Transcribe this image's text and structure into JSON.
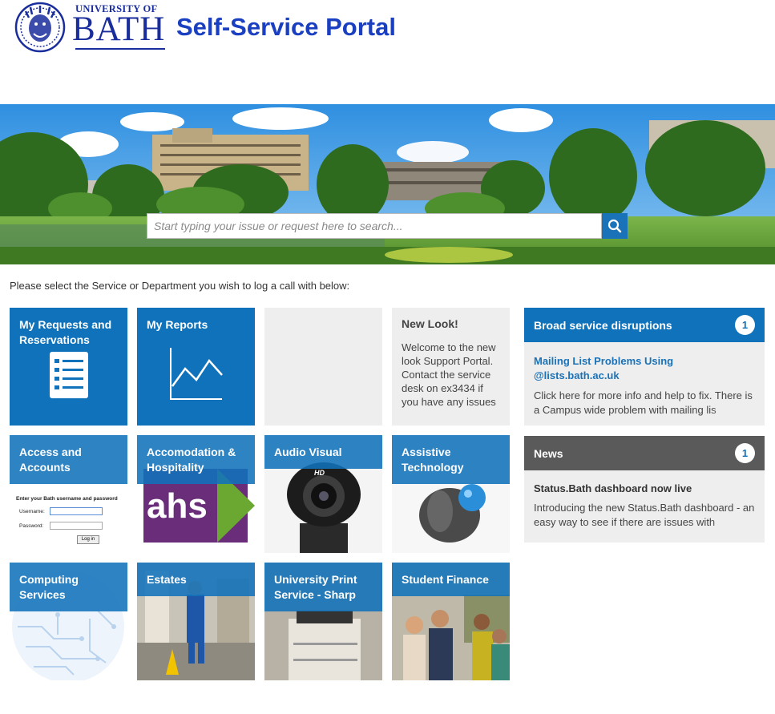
{
  "header": {
    "logo_university": "UNIVERSITY OF",
    "logo_bath": "BATH",
    "portal_title": "Self-Service Portal"
  },
  "search": {
    "placeholder": "Start typing your issue or request here to search...",
    "icon": "search-icon"
  },
  "intro_text": "Please select the Service or Department you wish to log a call with below:",
  "tiles": {
    "requests": {
      "label": "My Requests and Reservations",
      "icon": "list-icon"
    },
    "reports": {
      "label": "My Reports",
      "icon": "line-chart-icon"
    },
    "access": {
      "label": "Access and Accounts",
      "image_text": {
        "form_title": "Enter your Bath username and password",
        "username": "Username:",
        "password": "Password:",
        "login": "Log in"
      }
    },
    "accommodation": {
      "label": "Accomodation & Hospitality",
      "image_text": "ahs"
    },
    "audio_visual": {
      "label": "Audio Visual",
      "image_text": "HD"
    },
    "assistive": {
      "label": "Assistive Technology"
    },
    "computing": {
      "label": "Computing Services"
    },
    "estates": {
      "label": "Estates"
    },
    "print": {
      "label": "University Print Service - Sharp"
    },
    "finance": {
      "label": "Student Finance"
    }
  },
  "new_look": {
    "title": "New Look!",
    "body": "Welcome to the new look Support Portal. Contact the service desk on ex3434 if you have any issues"
  },
  "disruptions": {
    "title": "Broad service disruptions",
    "count": "1",
    "link": "Mailing List Problems Using @lists.bath.ac.uk",
    "text": "Click here for more info and help to fix. There is a Campus wide problem with mailing lis"
  },
  "news": {
    "title": "News",
    "count": "1",
    "item_title": "Status.Bath dashboard now live",
    "text": "Introducing the new Status.Bath dashboard - an easy way to see if there are issues with"
  },
  "colors": {
    "brand_blue": "#0f72bb",
    "title_blue": "#1a3fc0",
    "news_header": "#5a5a5a",
    "panel_bg": "#eeeeee"
  }
}
